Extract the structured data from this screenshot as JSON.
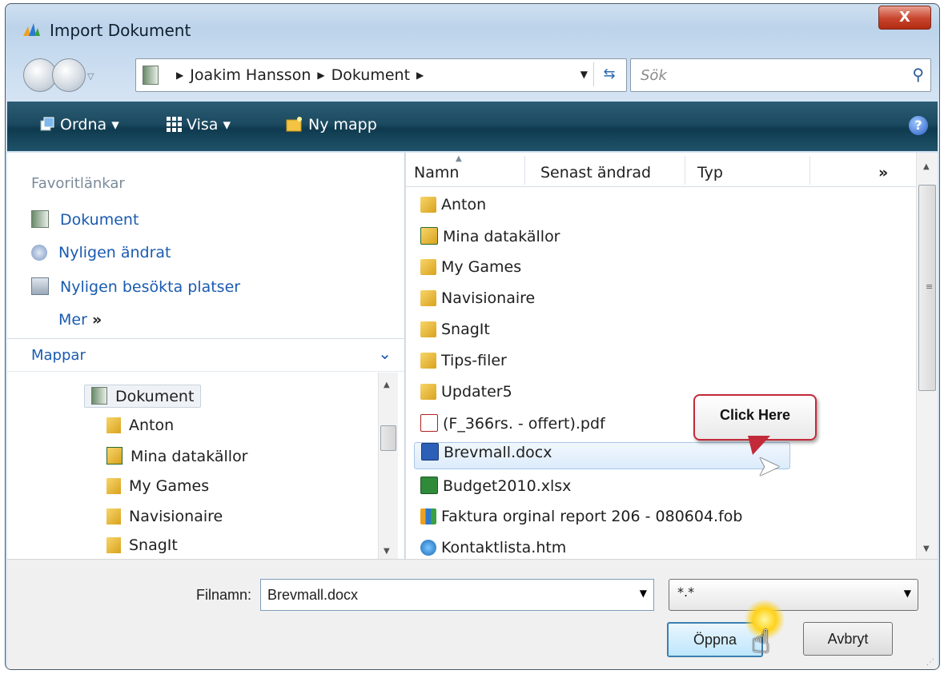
{
  "window": {
    "title": "Import Dokument",
    "close_label": "X"
  },
  "address": {
    "crumbs": [
      "Joakim Hansson",
      "Dokument"
    ],
    "search_placeholder": "Sök"
  },
  "toolbar": {
    "organize": "Ordna",
    "view": "Visa",
    "new_folder": "Ny mapp"
  },
  "sidebar": {
    "favorites_heading": "Favoritlänkar",
    "favorites": [
      "Dokument",
      "Nyligen ändrat",
      "Nyligen besökta platser"
    ],
    "more": "Mer",
    "folders_heading": "Mappar",
    "tree": [
      "Dokument",
      "Anton",
      "Mina datakällor",
      "My Games",
      "Navisionaire",
      "SnagIt"
    ]
  },
  "columns": [
    "Namn",
    "Senast ändrad",
    "Typ"
  ],
  "files": [
    {
      "name": "Anton",
      "icon": "folder-icon"
    },
    {
      "name": "Mina datakällor",
      "icon": "datasource-folder-icon"
    },
    {
      "name": "My Games",
      "icon": "folder-icon"
    },
    {
      "name": "Navisionaire",
      "icon": "folder-icon"
    },
    {
      "name": "SnagIt",
      "icon": "folder-icon"
    },
    {
      "name": "Tips-filer",
      "icon": "folder-icon"
    },
    {
      "name": "Updater5",
      "icon": "folder-icon"
    },
    {
      "name": "(F_366rs. - offert).pdf",
      "icon": "pdf-icon"
    },
    {
      "name": "Brevmall.docx",
      "icon": "word-icon",
      "selected": true
    },
    {
      "name": "Budget2010.xlsx",
      "icon": "excel-icon"
    },
    {
      "name": "Faktura orginal report 206 - 080604.fob",
      "icon": "fob-icon"
    },
    {
      "name": "Kontaktlista.htm",
      "icon": "ie-icon"
    }
  ],
  "callout": {
    "text": "Click Here"
  },
  "filename": {
    "label": "Filnamn:",
    "value": "Brevmall.docx"
  },
  "filetype": {
    "value": "*.*"
  },
  "buttons": {
    "open": "Öppna",
    "cancel": "Avbryt"
  },
  "colors": {
    "accent": "#1a5bb0",
    "commandbar": "#1c4a60",
    "callout_border": "#c22a3a"
  }
}
